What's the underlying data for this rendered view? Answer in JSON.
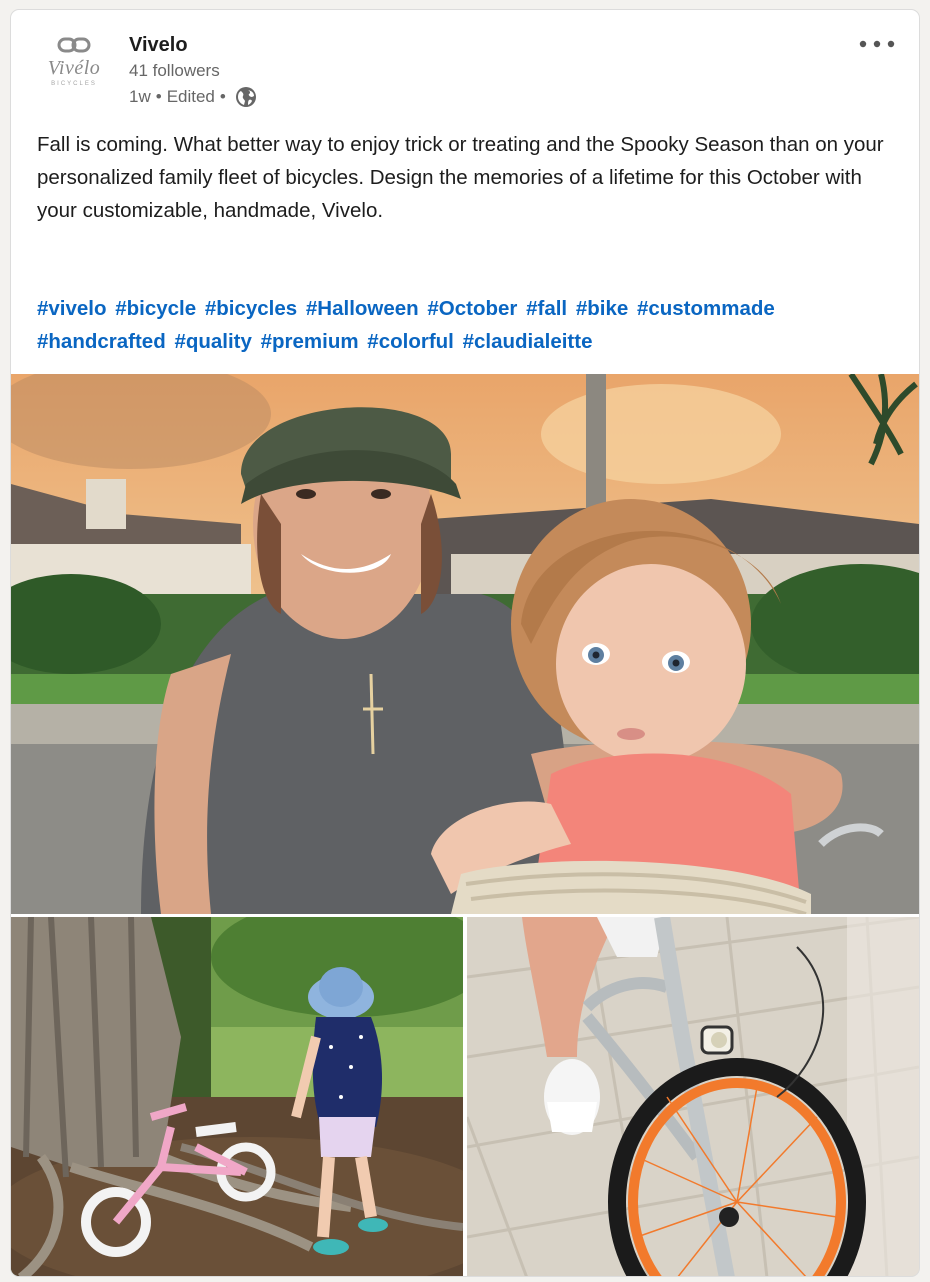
{
  "post": {
    "author": {
      "name": "Vivelo",
      "followers": "41 followers",
      "time": "1w",
      "edited": "Edited",
      "separator": "•",
      "logo_word": "Vivélo",
      "logo_sub": "BICYCLES"
    },
    "text": "Fall is coming. What better way to enjoy trick or treating and the Spooky Season than on your personalized family fleet of bicycles. Design the memories of a lifetime for this October with your customizable, handmade, Vivelo.",
    "hashtags": [
      "#vivelo",
      "#bicycle",
      "#bicycles",
      "#Halloween",
      "#October",
      "#fall",
      "#bike",
      "#custommade",
      "#handcrafted",
      "#quality",
      "#premium",
      "#colorful",
      "#claudialeitte"
    ]
  },
  "icons": {
    "more": "more-horizontal-icon",
    "visibility": "globe-icon"
  },
  "colors": {
    "hashtag": "#0a66c2",
    "text": "#1d1d1d",
    "secondary": "#666666"
  }
}
